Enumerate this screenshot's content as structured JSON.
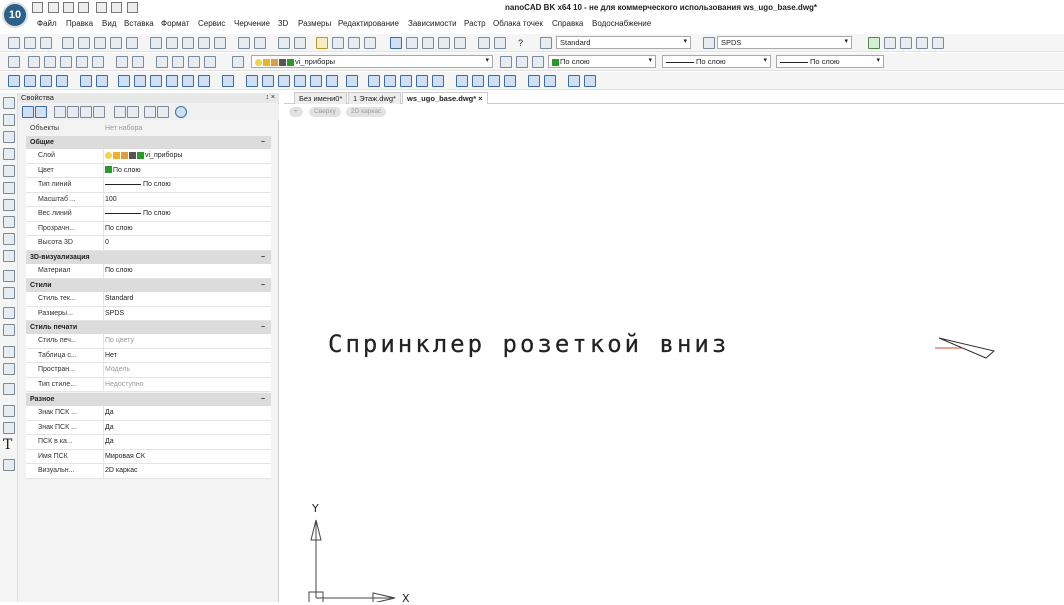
{
  "app": {
    "title": "nanoCAD BK x64 10 - не для коммерческого использования ws_ugo_base.dwg*",
    "logo_text": "10"
  },
  "menu": [
    "Файл",
    "Правка",
    "Вид",
    "Вставка",
    "Формат",
    "Сервис",
    "Черчение",
    "3D",
    "Размеры",
    "Редактирование",
    "Зависимости",
    "Растр",
    "Облака точек",
    "Справка",
    "Водоснабжение"
  ],
  "toolbar": {
    "text_style": "Standard",
    "dim_style": "SPDS",
    "layer": "vi_приборы",
    "color": "По слою",
    "linetype": "По слою",
    "lineweight": "По слою",
    "help_label": "?"
  },
  "properties": {
    "title": "Свойства",
    "header_controls": "↕ ×",
    "objects_key": "Объекты",
    "objects_value": "Нет набора",
    "groups": [
      {
        "name": "Общие",
        "rows": [
          {
            "k": "Слой",
            "v": "vi_приборы"
          },
          {
            "k": "Цвет",
            "v": "По слою"
          },
          {
            "k": "Тип линий",
            "v": "По слою"
          },
          {
            "k": "Масштаб ...",
            "v": "100"
          },
          {
            "k": "Вес линий",
            "v": "По слою"
          },
          {
            "k": "Прозрачн...",
            "v": "По слою"
          },
          {
            "k": "Высота 3D",
            "v": "0"
          }
        ]
      },
      {
        "name": "3D-визуализация",
        "rows": [
          {
            "k": "Материал",
            "v": "По слою"
          }
        ]
      },
      {
        "name": "Стили",
        "rows": [
          {
            "k": "Стиль тек...",
            "v": "Standard"
          },
          {
            "k": "Размеры...",
            "v": "SPDS"
          }
        ]
      },
      {
        "name": "Стиль печати",
        "rows": [
          {
            "k": "Стиль печ...",
            "v": "По цвету"
          },
          {
            "k": "Таблица с...",
            "v": "Нет"
          },
          {
            "k": "Простран...",
            "v": "Модель"
          },
          {
            "k": "Тип стиле...",
            "v": "Недоступно"
          }
        ]
      },
      {
        "name": "Разное",
        "rows": [
          {
            "k": "Знак ПСК ...",
            "v": "Да"
          },
          {
            "k": "Знак ПСК ...",
            "v": "Да"
          },
          {
            "k": "ПСК в ка...",
            "v": "Да"
          },
          {
            "k": "Имя ПСК",
            "v": "Мировая СК"
          },
          {
            "k": "Визуальн...",
            "v": "2D каркас"
          }
        ]
      }
    ]
  },
  "tabs": [
    "Без имени0*",
    "1 Этаж.dwg*",
    "ws_ugo_base.dwg*"
  ],
  "tab_close": "×",
  "view": {
    "plus": "+",
    "direction": "Сверху",
    "style": "2D каркас"
  },
  "canvas": {
    "label": "Спринклер розеткой вниз",
    "ucs_y": "Y",
    "ucs_x": "X"
  },
  "colors": {
    "accent": "#2c5f8a",
    "layer_green": "#2a9a2a",
    "panel_bg": "#f3f3f3"
  }
}
